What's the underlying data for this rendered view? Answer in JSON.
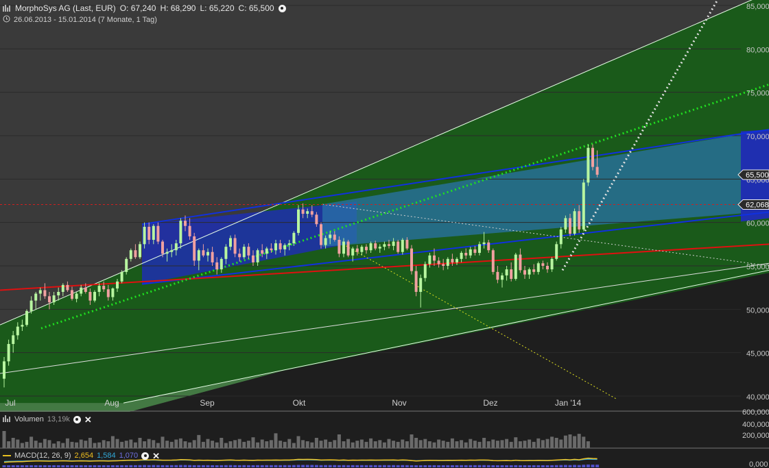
{
  "header": {
    "title": "MorphoSys AG (Last, EUR)",
    "open": "O: 67,240",
    "high": "H: 68,290",
    "low": "L: 65,220",
    "close": "C: 65,500",
    "range": "26.06.2013 - 15.01.2014 (7 Monate, 1 Tag)"
  },
  "volume_panel": {
    "label": "Volumen",
    "value": "13,19k",
    "ticks": [
      "600,000",
      "400,000",
      "200,000"
    ]
  },
  "macd_panel": {
    "label": "MACD(12, 26, 9)",
    "v1": "2,654",
    "v2": "1,584",
    "v3": "1,070",
    "tick": "0,000"
  },
  "colors": {
    "up": "#b8f5a0",
    "down": "#f0a0a0",
    "green_channel": "#1a5a1a",
    "blue_channel": "#1f2fb0",
    "red_line": "#e01010",
    "dotted_green": "#20e020"
  },
  "icons": [
    "bar-chart-icon",
    "clock-icon",
    "settings-circle-icon",
    "close-icon"
  ],
  "chart_data": {
    "type": "candlestick",
    "title": "MorphoSys AG (Last, EUR)",
    "x_ticks": [
      "Jul",
      "Aug",
      "Sep",
      "Okt",
      "Nov",
      "Dez",
      "Jan '14"
    ],
    "y_ticks": [
      "85,000",
      "80,000",
      "75,000",
      "70,000",
      "65,000",
      "60,000",
      "55,000",
      "50,000",
      "45,000",
      "40,000"
    ],
    "ylim": [
      39.5,
      85.5
    ],
    "price_labels": [
      "65,500",
      "62,068"
    ],
    "last": 65.5,
    "ref_level": 62.068,
    "candles": [
      [
        42,
        44.5,
        41,
        44
      ],
      [
        44,
        46.5,
        43.5,
        46
      ],
      [
        46,
        47.5,
        45,
        47
      ],
      [
        47,
        48.5,
        46.5,
        48
      ],
      [
        48,
        48.8,
        47.5,
        48.2
      ],
      [
        48.2,
        50,
        48,
        49.8
      ],
      [
        49.8,
        51.5,
        49.5,
        51
      ],
      [
        51,
        52,
        50,
        51.8
      ],
      [
        51.8,
        52.5,
        51,
        52.2
      ],
      [
        52.2,
        53,
        51.2,
        51.5
      ],
      [
        51.5,
        52,
        50,
        50.8
      ],
      [
        50.8,
        52,
        50.5,
        51.6
      ],
      [
        51.6,
        52.5,
        51,
        52
      ],
      [
        52,
        53,
        51.5,
        52.8
      ],
      [
        52.8,
        53.2,
        52,
        52.2
      ],
      [
        52.2,
        52.6,
        51,
        51.2
      ],
      [
        51.2,
        52,
        50.8,
        51.8
      ],
      [
        51.8,
        52.8,
        51.5,
        52.5
      ],
      [
        52.5,
        53,
        51.8,
        52
      ],
      [
        52,
        52.4,
        50.5,
        51
      ],
      [
        51,
        52.2,
        50.8,
        52
      ],
      [
        52,
        53,
        51.5,
        52.7
      ],
      [
        52.7,
        53.2,
        52,
        52.3
      ],
      [
        52.3,
        52.8,
        51,
        51.4
      ],
      [
        51.4,
        52.5,
        51,
        52.4
      ],
      [
        52.4,
        53.5,
        52,
        53.2
      ],
      [
        53.2,
        54.5,
        53,
        54.3
      ],
      [
        54.3,
        56,
        54,
        55.8
      ],
      [
        55.8,
        57,
        55.5,
        56.8
      ],
      [
        56.8,
        57.5,
        55.8,
        56
      ],
      [
        56,
        57.8,
        55.8,
        57.5
      ],
      [
        57.5,
        60,
        57,
        59.5
      ],
      [
        59.5,
        60,
        57.5,
        58
      ],
      [
        58,
        59.8,
        57.5,
        59.6
      ],
      [
        59.6,
        60,
        57.5,
        57.8
      ],
      [
        57.8,
        58,
        56,
        56.4
      ],
      [
        56.4,
        57,
        55.5,
        56.6
      ],
      [
        56.6,
        57.5,
        56,
        56.8
      ],
      [
        56.8,
        58,
        56.2,
        57.6
      ],
      [
        57.6,
        60.5,
        57,
        60.2
      ],
      [
        60.2,
        60.8,
        59,
        59.6
      ],
      [
        59.6,
        60.5,
        58,
        58.4
      ],
      [
        58.4,
        58.8,
        55,
        55.6
      ],
      [
        55.6,
        57,
        54.5,
        56.8
      ],
      [
        56.8,
        57.5,
        56,
        56.2
      ],
      [
        56.2,
        57,
        55.5,
        56.6
      ],
      [
        56.6,
        57.2,
        55,
        55.4
      ],
      [
        55.4,
        56,
        54,
        54.6
      ],
      [
        54.6,
        56,
        54.2,
        55.8
      ],
      [
        55.8,
        57.5,
        55.2,
        57.2
      ],
      [
        57.2,
        58.5,
        56.8,
        58.2
      ],
      [
        58.2,
        58.6,
        56,
        56.4
      ],
      [
        56.4,
        57,
        55.5,
        56
      ],
      [
        56,
        57.5,
        55.8,
        57.2
      ],
      [
        57.2,
        57.6,
        55.8,
        56.2
      ],
      [
        56.2,
        56.8,
        55,
        55.4
      ],
      [
        55.4,
        57,
        55,
        56.8
      ],
      [
        56.8,
        57.5,
        56,
        56.4
      ],
      [
        56.4,
        57.2,
        55.8,
        57
      ],
      [
        57,
        57.6,
        56.5,
        56.8
      ],
      [
        56.8,
        58,
        56.3,
        57.6
      ],
      [
        57.6,
        58,
        56.5,
        56.9
      ],
      [
        56.9,
        57.6,
        56.2,
        57.4
      ],
      [
        57.4,
        58,
        56.8,
        57.6
      ],
      [
        57.6,
        59,
        57.3,
        58.8
      ],
      [
        58.8,
        62,
        58.5,
        61.5
      ],
      [
        61.5,
        62.2,
        60.5,
        61
      ],
      [
        61,
        61.6,
        60.5,
        61.3
      ],
      [
        61.3,
        62,
        60.6,
        60.9
      ],
      [
        60.9,
        61.2,
        59.5,
        59.8
      ],
      [
        59.8,
        60,
        57,
        57.4
      ],
      [
        57.4,
        58.5,
        57,
        58.2
      ],
      [
        58.2,
        59,
        57.5,
        58.6
      ],
      [
        58.6,
        59,
        57.8,
        58
      ],
      [
        58,
        58.4,
        56,
        56.4
      ],
      [
        56.4,
        58.2,
        56,
        57.8
      ],
      [
        57.8,
        58,
        56,
        56.2
      ],
      [
        56.2,
        57.2,
        55.5,
        57
      ],
      [
        57,
        57.4,
        56.2,
        56.6
      ],
      [
        56.6,
        57.4,
        56.2,
        57.2
      ],
      [
        57.2,
        57.5,
        56.4,
        56.8
      ],
      [
        56.8,
        57.8,
        56.5,
        57.6
      ],
      [
        57.6,
        57.9,
        56.8,
        57
      ],
      [
        57,
        57.5,
        56.5,
        57.2
      ],
      [
        57.2,
        57.8,
        56.8,
        57.5
      ],
      [
        57.5,
        58,
        57,
        57.3
      ],
      [
        57.3,
        58.2,
        56.8,
        57.8
      ],
      [
        57.8,
        58,
        56.4,
        56.6
      ],
      [
        56.6,
        58.2,
        56.3,
        58
      ],
      [
        58,
        58.3,
        56.8,
        57
      ],
      [
        57,
        57.4,
        54,
        54.4
      ],
      [
        54.4,
        55,
        51.5,
        52
      ],
      [
        52,
        54,
        50.2,
        53.6
      ],
      [
        53.6,
        55.5,
        53.2,
        55.2
      ],
      [
        55.2,
        56.5,
        54.8,
        56.2
      ],
      [
        56.2,
        57,
        55,
        55.6
      ],
      [
        55.6,
        56,
        54.8,
        55.2
      ],
      [
        55.2,
        55.8,
        54.5,
        55
      ],
      [
        55,
        56,
        54.6,
        55.8
      ],
      [
        55.8,
        56.4,
        55,
        55.4
      ],
      [
        55.4,
        56,
        55.1,
        55.8
      ],
      [
        55.8,
        56.7,
        55.4,
        56.5
      ],
      [
        56.5,
        57,
        55.8,
        56.2
      ],
      [
        56.2,
        57.2,
        55.9,
        56.9
      ],
      [
        56.9,
        57.3,
        56.2,
        56.5
      ],
      [
        56.5,
        57.8,
        56.2,
        57.5
      ],
      [
        57.5,
        58.9,
        57,
        57.7
      ],
      [
        57.7,
        58,
        56.5,
        56.8
      ],
      [
        56.8,
        57,
        54,
        54.3
      ],
      [
        54.3,
        55,
        53,
        53.4
      ],
      [
        53.4,
        54.2,
        52.5,
        53.9
      ],
      [
        53.9,
        55,
        53.3,
        54.6
      ],
      [
        54.6,
        55.4,
        53.2,
        53.5
      ],
      [
        53.5,
        56.5,
        53.3,
        56.3
      ],
      [
        56.3,
        57,
        54.2,
        54.5
      ],
      [
        54.5,
        55,
        53.5,
        54
      ],
      [
        54,
        54.8,
        53.5,
        54.6
      ],
      [
        54.6,
        55.2,
        54,
        54.3
      ],
      [
        54.3,
        55.5,
        54,
        55.3
      ],
      [
        55.3,
        55.6,
        54.6,
        55
      ],
      [
        55,
        55.4,
        54.2,
        54.6
      ],
      [
        54.6,
        56,
        54.3,
        55.8
      ],
      [
        55.8,
        57.8,
        55.6,
        57.5
      ],
      [
        57.5,
        59.5,
        57,
        59.2
      ],
      [
        59.2,
        60.8,
        58.8,
        60.5
      ],
      [
        60.5,
        61,
        58.4,
        58.7
      ],
      [
        58.7,
        61.6,
        58.5,
        61.3
      ],
      [
        61.3,
        62,
        58.8,
        59.2
      ],
      [
        59.2,
        65,
        59,
        64.6
      ],
      [
        64.6,
        69,
        64.2,
        68.6
      ],
      [
        68.6,
        69,
        66,
        66.4
      ],
      [
        66.4,
        68.3,
        65.2,
        65.5
      ]
    ],
    "volume": [
      300,
      120,
      180,
      150,
      90,
      110,
      200,
      130,
      95,
      160,
      140,
      80,
      120,
      90,
      170,
      110,
      100,
      150,
      130,
      180,
      90,
      100,
      140,
      120,
      210,
      160,
      110,
      130,
      150,
      100,
      180,
      120,
      160,
      140,
      90,
      200,
      130,
      110,
      150,
      170,
      120,
      100,
      140,
      230,
      110,
      160,
      130,
      100,
      180,
      90,
      120,
      140,
      160,
      110,
      130,
      190,
      100,
      150,
      120,
      140,
      260,
      130,
      110,
      160,
      90,
      210,
      140,
      120,
      100,
      180,
      130,
      150,
      110,
      140,
      240,
      120,
      160,
      100,
      130,
      150,
      110,
      170,
      120,
      140,
      100,
      160,
      130,
      110,
      150,
      120,
      240,
      180,
      140,
      160,
      120,
      100,
      150,
      130,
      110,
      170,
      120,
      140,
      100,
      160,
      130,
      110,
      180,
      120,
      150,
      130,
      140,
      160,
      110,
      190,
      120,
      130,
      150,
      110,
      170,
      140,
      160,
      200,
      180,
      150,
      220,
      240,
      210,
      250,
      200,
      120
    ],
    "macd": {
      "macd": 2.654,
      "signal": 1.584,
      "histogram": 1.07
    }
  }
}
